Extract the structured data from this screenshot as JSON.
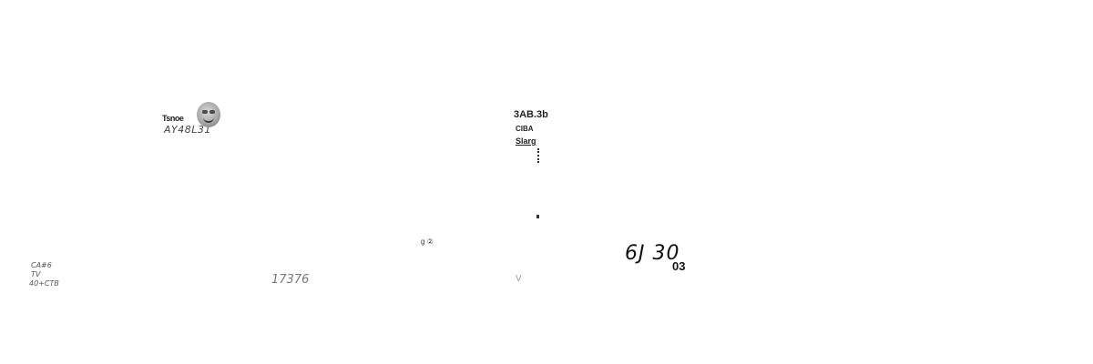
{
  "fragments": {
    "top_left_line1": "Tsnoe",
    "top_left_line2": "AY48L31",
    "top_center_line1": "3AB.3b",
    "top_center_line2": "CIBA",
    "top_center_line3": "Slarg",
    "center_small_mark": "g ②",
    "right_large": "6J 30",
    "right_small": "03",
    "bottom_left_line1": "CA#6",
    "bottom_left_line2": "TV",
    "bottom_left_line3": "40+CTB",
    "bottom_center_left": "17376",
    "faint_mark": "V"
  }
}
